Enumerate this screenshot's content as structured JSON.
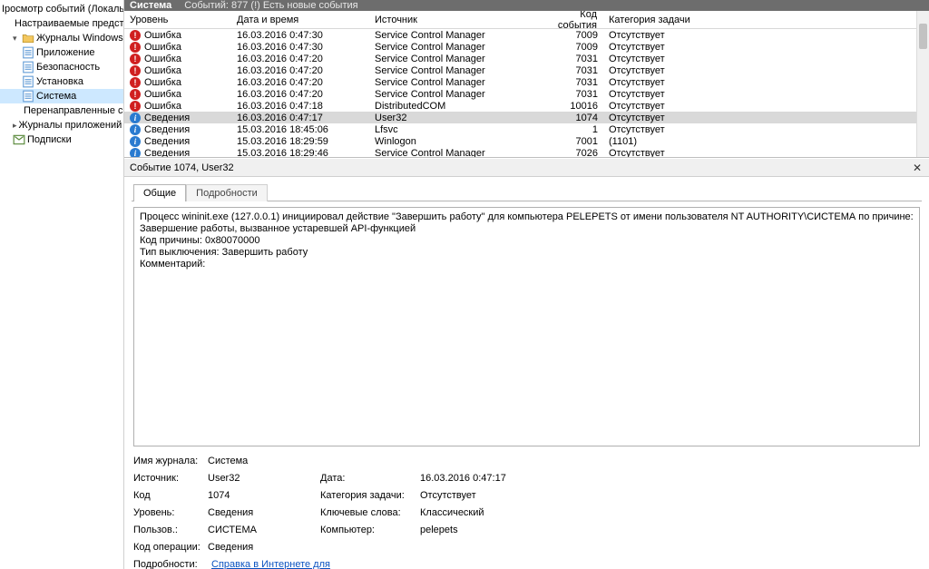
{
  "tree": {
    "root": "Іросмотр событий (Локальны",
    "custom_views": "Настраиваемые представле",
    "win_logs": "Журналы Windows",
    "items": [
      {
        "label": "Приложение"
      },
      {
        "label": "Безопасность"
      },
      {
        "label": "Установка"
      },
      {
        "label": "Система",
        "selected": true
      },
      {
        "label": "Перенаправленные соб"
      }
    ],
    "app_svc_logs": "Журналы приложений и сл",
    "subscriptions": "Подписки"
  },
  "titlebar": {
    "name": "Система",
    "sub": "Событий: 877 (!) Есть новые события"
  },
  "columns": {
    "level": "Уровень",
    "datetime": "Дата и время",
    "source": "Источник",
    "eid": "Код события",
    "cat": "Категория задачи"
  },
  "rows": [
    {
      "ic": "err",
      "level": "Ошибка",
      "dt": "16.03.2016 0:47:30",
      "src": "Service Control Manager",
      "eid": "7009",
      "cat": "Отсутствует"
    },
    {
      "ic": "err",
      "level": "Ошибка",
      "dt": "16.03.2016 0:47:30",
      "src": "Service Control Manager",
      "eid": "7009",
      "cat": "Отсутствует"
    },
    {
      "ic": "err",
      "level": "Ошибка",
      "dt": "16.03.2016 0:47:20",
      "src": "Service Control Manager",
      "eid": "7031",
      "cat": "Отсутствует"
    },
    {
      "ic": "err",
      "level": "Ошибка",
      "dt": "16.03.2016 0:47:20",
      "src": "Service Control Manager",
      "eid": "7031",
      "cat": "Отсутствует"
    },
    {
      "ic": "err",
      "level": "Ошибка",
      "dt": "16.03.2016 0:47:20",
      "src": "Service Control Manager",
      "eid": "7031",
      "cat": "Отсутствует"
    },
    {
      "ic": "err",
      "level": "Ошибка",
      "dt": "16.03.2016 0:47:20",
      "src": "Service Control Manager",
      "eid": "7031",
      "cat": "Отсутствует"
    },
    {
      "ic": "err",
      "level": "Ошибка",
      "dt": "16.03.2016 0:47:18",
      "src": "DistributedCOM",
      "eid": "10016",
      "cat": "Отсутствует"
    },
    {
      "ic": "info",
      "level": "Сведения",
      "dt": "16.03.2016 0:47:17",
      "src": "User32",
      "eid": "1074",
      "cat": "Отсутствует",
      "selected": true
    },
    {
      "ic": "info",
      "level": "Сведения",
      "dt": "15.03.2016 18:45:06",
      "src": "Lfsvc",
      "eid": "1",
      "cat": "Отсутствует"
    },
    {
      "ic": "info",
      "level": "Сведения",
      "dt": "15.03.2016 18:29:59",
      "src": "Winlogon",
      "eid": "7001",
      "cat": "(1101)"
    },
    {
      "ic": "info",
      "level": "Сведения",
      "dt": "15.03.2016 18:29:46",
      "src": "Service Control Manager",
      "eid": "7026",
      "cat": "Отсутствует"
    }
  ],
  "detail": {
    "title": "Событие 1074, User32",
    "tabs": {
      "general": "Общие",
      "details": "Подробности"
    },
    "msg_lines": [
      "Процесс wininit.exe (127.0.0.1) инициировал действие \"Завершить работу\" для компьютера PELEPETS от имени пользователя NT AUTHORITY\\СИСТЕМА по причине: Завершение работы, вызванное устаревшей API-функцией",
      "Код причины: 0x80070000",
      "Тип выключения: Завершить работу",
      "Комментарий:"
    ],
    "labels": {
      "logname": "Имя журнала:",
      "source": "Источник:",
      "date": "Дата:",
      "eid": "Код",
      "cat": "Категория задачи:",
      "level": "Уровень:",
      "keywords": "Ключевые слова:",
      "user": "Пользов.:",
      "computer": "Компьютер:",
      "opcode": "Код операции:",
      "moreinfo": "Подробности:"
    },
    "values": {
      "logname": "Система",
      "source": "User32",
      "date": "16.03.2016 0:47:17",
      "eid": "1074",
      "cat": "Отсутствует",
      "level": "Сведения",
      "keywords": "Классический",
      "user": "СИСТЕМА",
      "computer": "pelepets",
      "opcode": "Сведения",
      "helplink": "Справка в Интернете для"
    }
  }
}
